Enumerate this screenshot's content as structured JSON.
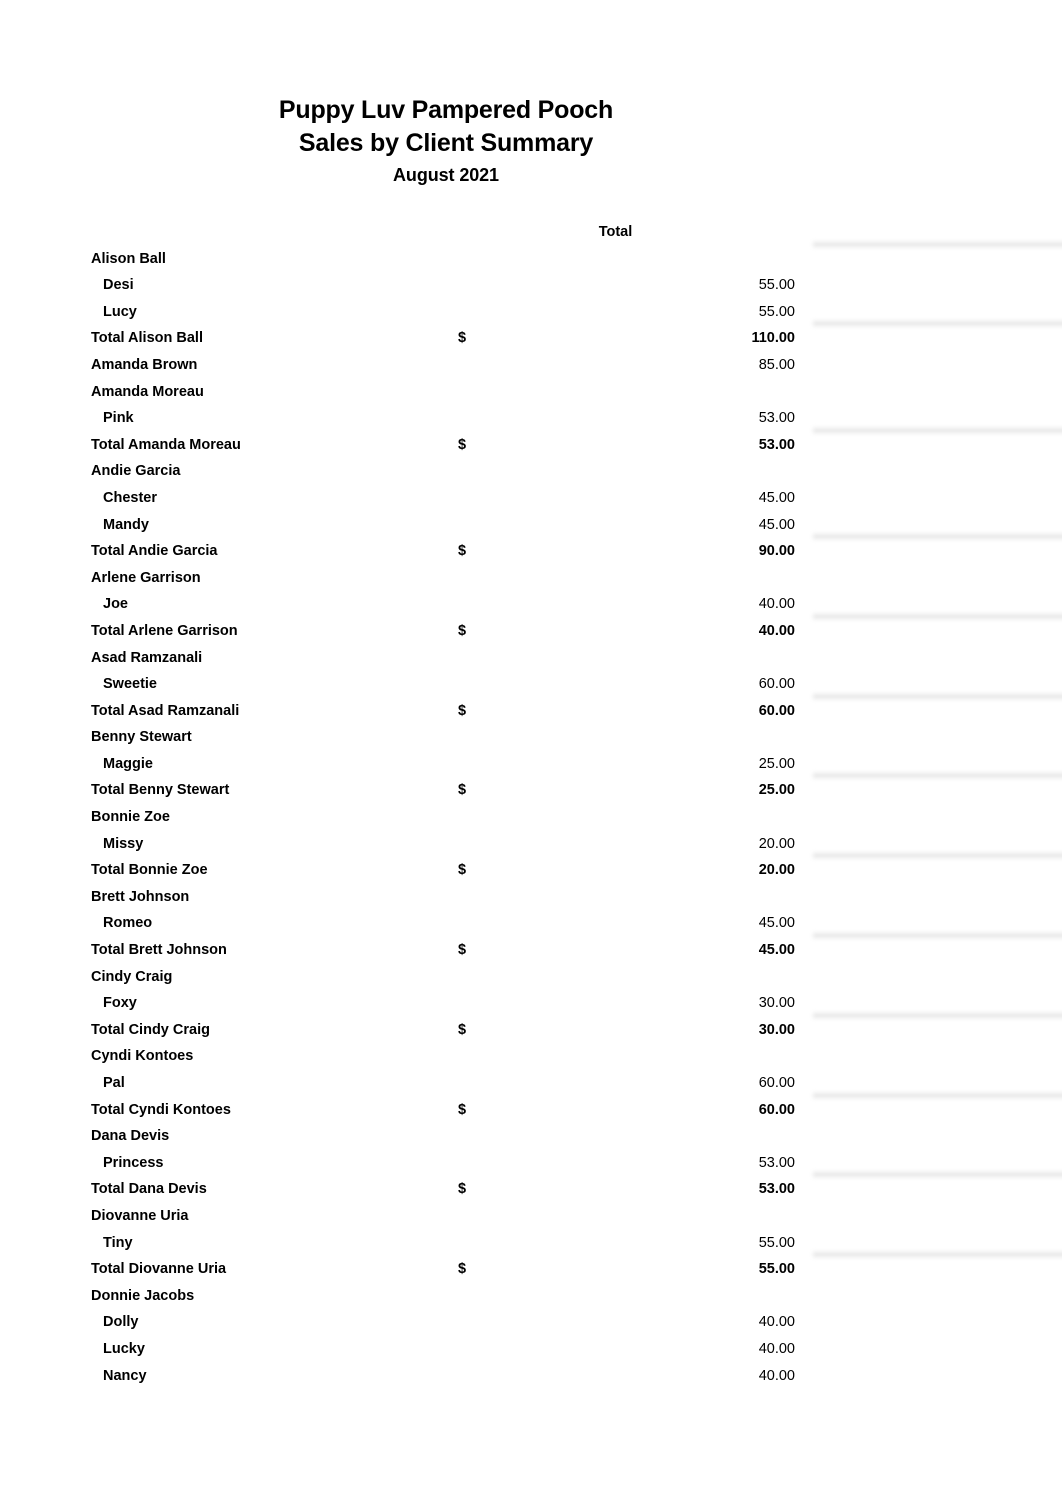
{
  "report": {
    "company": "Puppy Luv Pampered Pooch",
    "title": "Sales by Client Summary",
    "period": "August 2021",
    "column_header": "Total",
    "currency_symbol": "$"
  },
  "rows": [
    {
      "type": "client",
      "label": "Alison Ball",
      "amount": ""
    },
    {
      "type": "pet",
      "label": "Desi",
      "amount": "55.00"
    },
    {
      "type": "pet",
      "label": "Lucy",
      "amount": "55.00",
      "rule_after": true
    },
    {
      "type": "subtotal",
      "label": "Total Alison Ball",
      "amount": "110.00",
      "currency": "$"
    },
    {
      "type": "client",
      "label": "Amanda Brown",
      "amount": "85.00"
    },
    {
      "type": "client",
      "label": "Amanda Moreau",
      "amount": ""
    },
    {
      "type": "pet",
      "label": "Pink",
      "amount": "53.00",
      "rule_after": true
    },
    {
      "type": "subtotal",
      "label": "Total Amanda Moreau",
      "amount": "53.00",
      "currency": "$"
    },
    {
      "type": "client",
      "label": "Andie Garcia",
      "amount": ""
    },
    {
      "type": "pet",
      "label": "Chester",
      "amount": "45.00"
    },
    {
      "type": "pet",
      "label": "Mandy",
      "amount": "45.00",
      "rule_after": true
    },
    {
      "type": "subtotal",
      "label": "Total Andie Garcia",
      "amount": "90.00",
      "currency": "$"
    },
    {
      "type": "client",
      "label": "Arlene Garrison",
      "amount": ""
    },
    {
      "type": "pet",
      "label": "Joe",
      "amount": "40.00",
      "rule_after": true
    },
    {
      "type": "subtotal",
      "label": "Total Arlene Garrison",
      "amount": "40.00",
      "currency": "$"
    },
    {
      "type": "client",
      "label": "Asad Ramzanali",
      "amount": ""
    },
    {
      "type": "pet",
      "label": "Sweetie",
      "amount": "60.00",
      "rule_after": true
    },
    {
      "type": "subtotal",
      "label": "Total Asad Ramzanali",
      "amount": "60.00",
      "currency": "$"
    },
    {
      "type": "client",
      "label": "Benny Stewart",
      "amount": ""
    },
    {
      "type": "pet",
      "label": "Maggie",
      "amount": "25.00",
      "rule_after": true
    },
    {
      "type": "subtotal",
      "label": "Total Benny Stewart",
      "amount": "25.00",
      "currency": "$"
    },
    {
      "type": "client",
      "label": "Bonnie Zoe",
      "amount": ""
    },
    {
      "type": "pet",
      "label": "Missy",
      "amount": "20.00",
      "rule_after": true
    },
    {
      "type": "subtotal",
      "label": "Total Bonnie Zoe",
      "amount": "20.00",
      "currency": "$"
    },
    {
      "type": "client",
      "label": "Brett Johnson",
      "amount": ""
    },
    {
      "type": "pet",
      "label": "Romeo",
      "amount": "45.00",
      "rule_after": true
    },
    {
      "type": "subtotal",
      "label": "Total Brett Johnson",
      "amount": "45.00",
      "currency": "$"
    },
    {
      "type": "client",
      "label": "Cindy Craig",
      "amount": ""
    },
    {
      "type": "pet",
      "label": "Foxy",
      "amount": "30.00",
      "rule_after": true
    },
    {
      "type": "subtotal",
      "label": "Total Cindy Craig",
      "amount": "30.00",
      "currency": "$"
    },
    {
      "type": "client",
      "label": "Cyndi Kontoes",
      "amount": ""
    },
    {
      "type": "pet",
      "label": "Pal",
      "amount": "60.00",
      "rule_after": true
    },
    {
      "type": "subtotal",
      "label": "Total Cyndi Kontoes",
      "amount": "60.00",
      "currency": "$"
    },
    {
      "type": "client",
      "label": "Dana Devis",
      "amount": ""
    },
    {
      "type": "pet",
      "label": "Princess",
      "amount": "53.00",
      "rule_after": true
    },
    {
      "type": "subtotal",
      "label": "Total Dana Devis",
      "amount": "53.00",
      "currency": "$"
    },
    {
      "type": "client",
      "label": "Diovanne Uria",
      "amount": ""
    },
    {
      "type": "pet",
      "label": "Tiny",
      "amount": "55.00",
      "rule_after": true
    },
    {
      "type": "subtotal",
      "label": "Total Diovanne Uria",
      "amount": "55.00",
      "currency": "$"
    },
    {
      "type": "client",
      "label": "Donnie Jacobs",
      "amount": ""
    },
    {
      "type": "pet",
      "label": "Dolly",
      "amount": "40.00"
    },
    {
      "type": "pet",
      "label": "Lucky",
      "amount": "40.00"
    },
    {
      "type": "pet",
      "label": "Nancy",
      "amount": "40.00"
    }
  ]
}
